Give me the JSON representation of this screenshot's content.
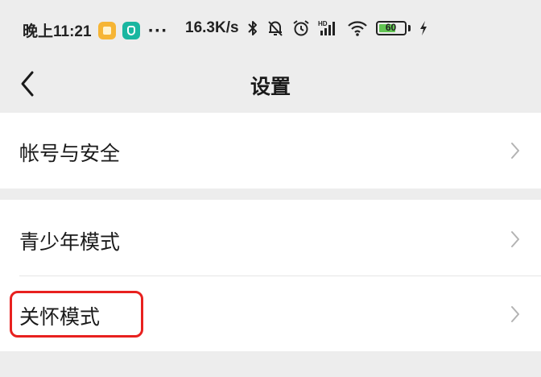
{
  "status_bar": {
    "time": "晚上11:21",
    "dots": "···",
    "net_speed": "16.3K/s",
    "battery_level": "60",
    "battery_color": "#62c553",
    "icons": [
      "notes-app-icon",
      "security-app-icon",
      "bluetooth-icon",
      "bell-muted-icon",
      "alarm-icon",
      "hd-signal-icon",
      "wifi-icon",
      "battery-icon",
      "charging-icon"
    ]
  },
  "nav": {
    "back_icon": "chevron-left-icon",
    "title": "设置"
  },
  "settings": {
    "account_security": "帐号与安全",
    "youth_mode": "青少年模式",
    "care_mode": "关怀模式"
  },
  "highlight_color": "#e8211f"
}
